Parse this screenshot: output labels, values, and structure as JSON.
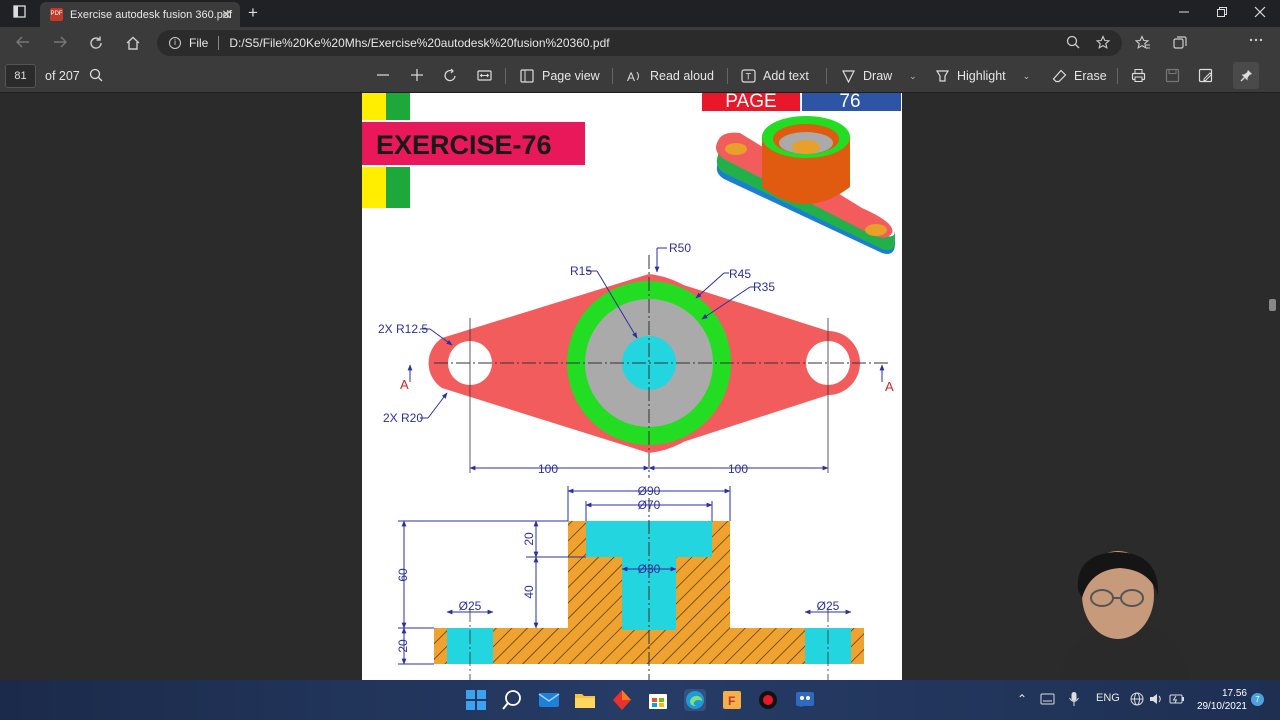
{
  "browser": {
    "tab_title": "Exercise autodesk fusion 360.pdf",
    "tab_close": "✕",
    "new_tab": "+",
    "url_scheme_label": "File",
    "url": "D:/S5/File%20Ke%20Mhs/Exercise%20autodesk%20fusion%20360.pdf"
  },
  "pdf_toolbar": {
    "page_current": "81",
    "page_total": "of 207",
    "page_view": "Page view",
    "read_aloud": "Read aloud",
    "add_text": "Add text",
    "draw": "Draw",
    "highlight": "Highlight",
    "erase": "Erase"
  },
  "document": {
    "exercise_title": "EXERCISE-76",
    "page_label": "PAGE",
    "page_number": "76",
    "dims": {
      "r50": "R50",
      "r15": "R15",
      "r45": "R45",
      "r35": "R35",
      "r12_5": "2X R12.5",
      "r20": "2X R20",
      "section_a_left": "A",
      "section_a_right": "A",
      "d100_left": "100",
      "d100_right": "100",
      "d90": "Ø90",
      "d70": "Ø70",
      "d30": "Ø30",
      "d25_left": "Ø25",
      "d25_right": "Ø25",
      "v20_top": "20",
      "v40": "40",
      "v60": "60",
      "v20_bottom": "20"
    },
    "colors": {
      "body": "#f25c5c",
      "ring": "#22dd22",
      "gray": "#aaaaaa",
      "cyan": "#22d5de",
      "hatch": "#f0a22e",
      "dim": "#2b2fa0",
      "title_bg": "#e8185a"
    }
  },
  "taskbar": {
    "language": "ENG",
    "time": "17.56",
    "date": "29/10/2021",
    "notifications": "7"
  }
}
